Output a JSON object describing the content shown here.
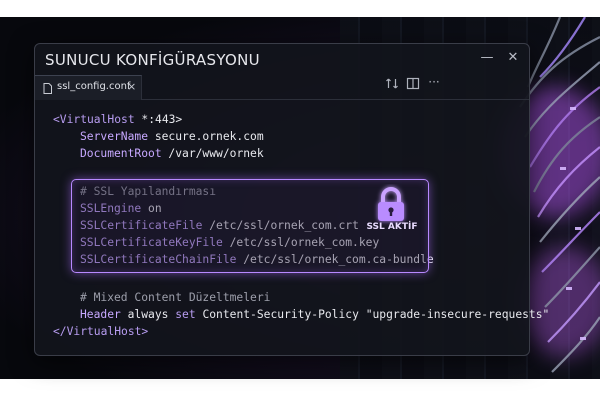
{
  "window": {
    "title": "SUNUCU KONFİGÜRASYONU",
    "controls": {
      "minimize": "—",
      "close": "✕"
    }
  },
  "tab": {
    "label": "ssl_config.conf",
    "close": "×",
    "icon": "file-icon"
  },
  "toolbar": {
    "icons": [
      "compare-changes-icon",
      "split-editor-icon",
      "more-actions-icon"
    ],
    "more": "···"
  },
  "code": {
    "vhost_open_tag": "<VirtualHost",
    "vhost_open_arg": " *:443>",
    "server_name_key": "ServerName",
    "server_name_val": " secure.ornek.com",
    "doc_root_key": "DocumentRoot",
    "doc_root_val": " /var/www/ornek",
    "ssl_comment": "# SSL Yapılandırması",
    "ssl_engine_key": "SSLEngine",
    "ssl_engine_val": " on",
    "cert_file_key": "SSLCertificateFile",
    "cert_file_val": " /etc/ssl/ornek_com.crt",
    "cert_key_key": "SSLCertificateKeyFile",
    "cert_key_val": " /etc/ssl/ornek_com.key",
    "chain_file_key": "SSLCertificateChainFile",
    "chain_file_val": " /etc/ssl/ornek_com.ca-bundle",
    "mixed_comment": "# Mixed Content Düzeltmeleri",
    "header_key": "Header",
    "header_mid": " always ",
    "header_set": "set",
    "header_rest": " Content-Security-Policy ",
    "header_val": "\"upgrade-insecure-requests\"",
    "vhost_close": "</VirtualHost>"
  },
  "badge": {
    "label": "SSL AKTİF",
    "icon": "lock-icon"
  },
  "colors": {
    "accent": "#b889ff",
    "keyword": "#b79cf0",
    "comment": "#9d9fab",
    "text": "#e8e9ee",
    "window_bg": "#12141c"
  }
}
